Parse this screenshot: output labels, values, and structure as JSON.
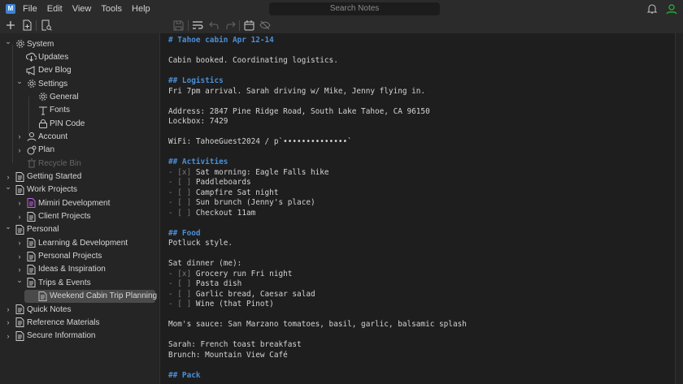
{
  "menubar": {
    "items": [
      "File",
      "Edit",
      "View",
      "Tools",
      "Help"
    ],
    "search_placeholder": "Search Notes"
  },
  "colors": {
    "accent": "#4a8fd8",
    "user_online": "#22a832",
    "special_note": "#c062e0"
  },
  "sidebar": {
    "items": [
      {
        "label": "System",
        "depth": 0,
        "chev": "open",
        "icon": "gear-icon"
      },
      {
        "label": "Updates",
        "depth": 1,
        "chev": "none",
        "icon": "cloud-download-icon"
      },
      {
        "label": "Dev Blog",
        "depth": 1,
        "chev": "none",
        "icon": "megaphone-icon"
      },
      {
        "label": "Settings",
        "depth": 1,
        "chev": "open",
        "icon": "gear-icon"
      },
      {
        "label": "General",
        "depth": 2,
        "chev": "none",
        "icon": "gear-icon"
      },
      {
        "label": "Fonts",
        "depth": 2,
        "chev": "none",
        "icon": "type-icon"
      },
      {
        "label": "PIN Code",
        "depth": 2,
        "chev": "none",
        "icon": "lock-icon"
      },
      {
        "label": "Account",
        "depth": 1,
        "chev": "closed",
        "icon": "user-icon"
      },
      {
        "label": "Plan",
        "depth": 1,
        "chev": "closed",
        "icon": "plan-icon"
      },
      {
        "label": "Recycle Bin",
        "depth": 1,
        "chev": "none",
        "icon": "trash-icon",
        "dim": true
      },
      {
        "label": "Getting Started",
        "depth": 0,
        "chev": "closed",
        "icon": "note-icon"
      },
      {
        "label": "Work Projects",
        "depth": 0,
        "chev": "open",
        "icon": "note-icon"
      },
      {
        "label": "Mimiri Development",
        "depth": 1,
        "chev": "closed",
        "icon": "note-icon",
        "special": true
      },
      {
        "label": "Client Projects",
        "depth": 1,
        "chev": "closed",
        "icon": "note-icon"
      },
      {
        "label": "Personal",
        "depth": 0,
        "chev": "open",
        "icon": "note-icon"
      },
      {
        "label": "Learning & Development",
        "depth": 1,
        "chev": "closed",
        "icon": "note-icon"
      },
      {
        "label": "Personal Projects",
        "depth": 1,
        "chev": "closed",
        "icon": "note-icon"
      },
      {
        "label": "Ideas & Inspiration",
        "depth": 1,
        "chev": "closed",
        "icon": "note-icon"
      },
      {
        "label": "Trips & Events",
        "depth": 1,
        "chev": "open",
        "icon": "note-icon"
      },
      {
        "label": "Weekend Cabin Trip Planning",
        "depth": 2,
        "chev": "none",
        "icon": "note-icon",
        "selected": true
      },
      {
        "label": "Quick Notes",
        "depth": 0,
        "chev": "closed",
        "icon": "note-icon"
      },
      {
        "label": "Reference Materials",
        "depth": 0,
        "chev": "closed",
        "icon": "note-icon"
      },
      {
        "label": "Secure Information",
        "depth": 0,
        "chev": "closed",
        "icon": "note-icon"
      }
    ]
  },
  "editor": {
    "lines": [
      {
        "t": "h",
        "text": "# Tahoe cabin Apr 12-14"
      },
      {
        "t": "p",
        "text": ""
      },
      {
        "t": "p",
        "text": "Cabin booked. Coordinating logistics."
      },
      {
        "t": "p",
        "text": ""
      },
      {
        "t": "h",
        "text": "## Logistics"
      },
      {
        "t": "p",
        "text": "Fri 7pm arrival. Sarah driving w/ Mike, Jenny flying in."
      },
      {
        "t": "p",
        "text": ""
      },
      {
        "t": "p",
        "text": "Address: 2847 Pine Ridge Road, South Lake Tahoe, CA 96150"
      },
      {
        "t": "p",
        "text": "Lockbox: 7429"
      },
      {
        "t": "p",
        "text": ""
      },
      {
        "t": "p",
        "text": "WiFi: TahoeGuest2024 / p`••••••••••••••`"
      },
      {
        "t": "p",
        "text": ""
      },
      {
        "t": "h",
        "text": "## Activities"
      },
      {
        "t": "c",
        "mk": "- [x] ",
        "text": "Sat morning: Eagle Falls hike"
      },
      {
        "t": "c",
        "mk": "- [ ] ",
        "text": "Paddleboards"
      },
      {
        "t": "c",
        "mk": "- [ ] ",
        "text": "Campfire Sat night"
      },
      {
        "t": "c",
        "mk": "- [ ] ",
        "text": "Sun brunch (Jenny's place)"
      },
      {
        "t": "c",
        "mk": "- [ ] ",
        "text": "Checkout 11am"
      },
      {
        "t": "p",
        "text": ""
      },
      {
        "t": "h",
        "text": "## Food"
      },
      {
        "t": "p",
        "text": "Potluck style."
      },
      {
        "t": "p",
        "text": ""
      },
      {
        "t": "p",
        "text": "Sat dinner (me):"
      },
      {
        "t": "c",
        "mk": "- [x] ",
        "text": "Grocery run Fri night"
      },
      {
        "t": "c",
        "mk": "- [ ] ",
        "text": "Pasta dish"
      },
      {
        "t": "c",
        "mk": "- [ ] ",
        "text": "Garlic bread, Caesar salad"
      },
      {
        "t": "c",
        "mk": "- [ ] ",
        "text": "Wine (that Pinot)"
      },
      {
        "t": "p",
        "text": ""
      },
      {
        "t": "p",
        "text": "Mom's sauce: San Marzano tomatoes, basil, garlic, balsamic splash"
      },
      {
        "t": "p",
        "text": ""
      },
      {
        "t": "p",
        "text": "Sarah: French toast breakfast"
      },
      {
        "t": "p",
        "text": "Brunch: Mountain View Café"
      },
      {
        "t": "p",
        "text": ""
      },
      {
        "t": "h",
        "text": "## Pack"
      }
    ]
  }
}
